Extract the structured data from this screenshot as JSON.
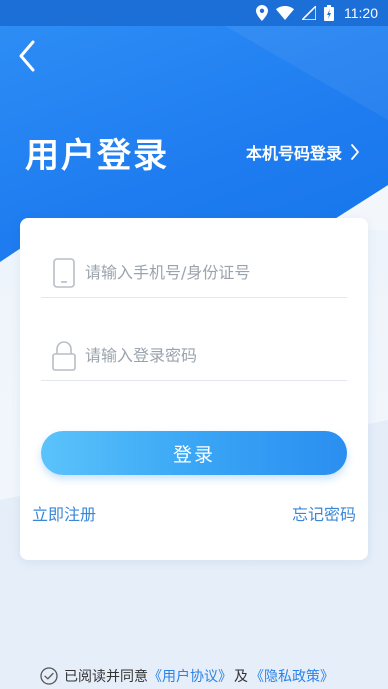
{
  "status_bar": {
    "time": "11:20",
    "icons": [
      "location-icon",
      "wifi-icon",
      "signal-icon",
      "battery-icon"
    ]
  },
  "header": {
    "back_icon": "chevron-left-icon",
    "title": "用户登录",
    "alt_login_label": "本机号码登录",
    "alt_login_icon": "chevron-right-icon"
  },
  "form": {
    "phone_placeholder": "请输入手机号/身份证号",
    "phone_value": "",
    "phone_icon": "phone-icon",
    "password_placeholder": "请输入登录密码",
    "password_value": "",
    "password_icon": "lock-icon",
    "login_label": "登录",
    "register_label": "立即注册",
    "forgot_label": "忘记密码"
  },
  "agreement": {
    "checked": false,
    "prefix": "已阅读并同意",
    "user_agreement": "《用户协议》",
    "and": "及",
    "privacy_policy": "《隐私政策》"
  },
  "colors": {
    "primary_blue": "#1e7cf0",
    "button_gradient_start": "#5bc3fb",
    "button_gradient_end": "#2a8ef0",
    "link": "#3a87d8"
  }
}
